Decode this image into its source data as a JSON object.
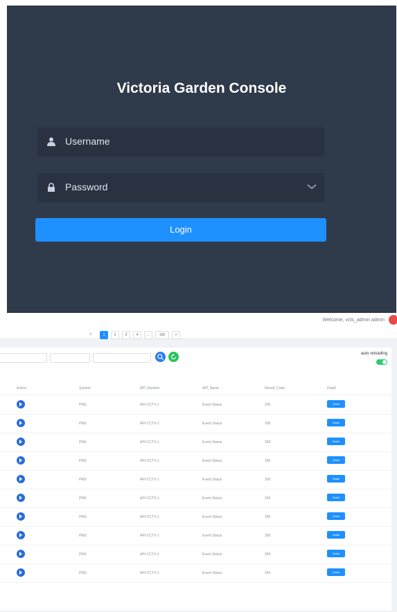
{
  "login": {
    "title": "Victoria Garden Console",
    "username_label": "Username",
    "password_label": "Password",
    "login_button": "Login"
  },
  "header": {
    "welcome": "Welcome, vcts_admin admin"
  },
  "toolbar": {
    "auto_reload_label": "auto reloading",
    "auto_reload_on": true
  },
  "table": {
    "columns": [
      "Action",
      "System",
      "API_Number",
      "API_Name",
      "Result_Code",
      "Detail"
    ],
    "rows": [
      {
        "system": "PMS",
        "api_number": "API-CCTV-1",
        "api_name": "Event Status",
        "result_code": "200",
        "detail": "Detail"
      },
      {
        "system": "PMS",
        "api_number": "API-CCTV-1",
        "api_name": "Event Status",
        "result_code": "200",
        "detail": "Detail"
      },
      {
        "system": "PMS",
        "api_number": "API-CCTV-1",
        "api_name": "Event Status",
        "result_code": "200",
        "detail": "Detail"
      },
      {
        "system": "PMS",
        "api_number": "API-CCTV-1",
        "api_name": "Event Status",
        "result_code": "200",
        "detail": "Detail"
      },
      {
        "system": "PMS",
        "api_number": "API-CCTV-1",
        "api_name": "Event Status",
        "result_code": "200",
        "detail": "Detail"
      },
      {
        "system": "PMS",
        "api_number": "API-CCTV-1",
        "api_name": "Event Status",
        "result_code": "200",
        "detail": "Detail"
      },
      {
        "system": "PMS",
        "api_number": "API-CCTV-1",
        "api_name": "Event Status",
        "result_code": "200",
        "detail": "Detail"
      },
      {
        "system": "PMS",
        "api_number": "API-CCTV-1",
        "api_name": "Event Status",
        "result_code": "200",
        "detail": "Detail"
      },
      {
        "system": "PMS",
        "api_number": "API-CCTV-1",
        "api_name": "Event Status",
        "result_code": "200",
        "detail": "Detail"
      },
      {
        "system": "PMS",
        "api_number": "API-CCTV-1",
        "api_name": "Event Status",
        "result_code": "200",
        "detail": "Detail"
      }
    ]
  },
  "pagination": {
    "prev": "<",
    "pages": [
      "1",
      "2",
      "3",
      "4"
    ],
    "ellipsis": "...",
    "last": "100",
    "next": ">",
    "active_page": "1"
  },
  "colors": {
    "login_bg": "#2f3a4b",
    "field_bg": "#283240",
    "accent": "#1e90ff",
    "search_button": "#2a7df0",
    "refresh_button": "#27c25a",
    "toggle": "#2ecc71",
    "avatar": "#e94b4b"
  },
  "icons": {
    "username": "user-icon",
    "password": "lock-icon",
    "dropdown": "chevron-down-icon",
    "search": "search-icon",
    "refresh": "refresh-icon",
    "row_action": "play-icon"
  }
}
